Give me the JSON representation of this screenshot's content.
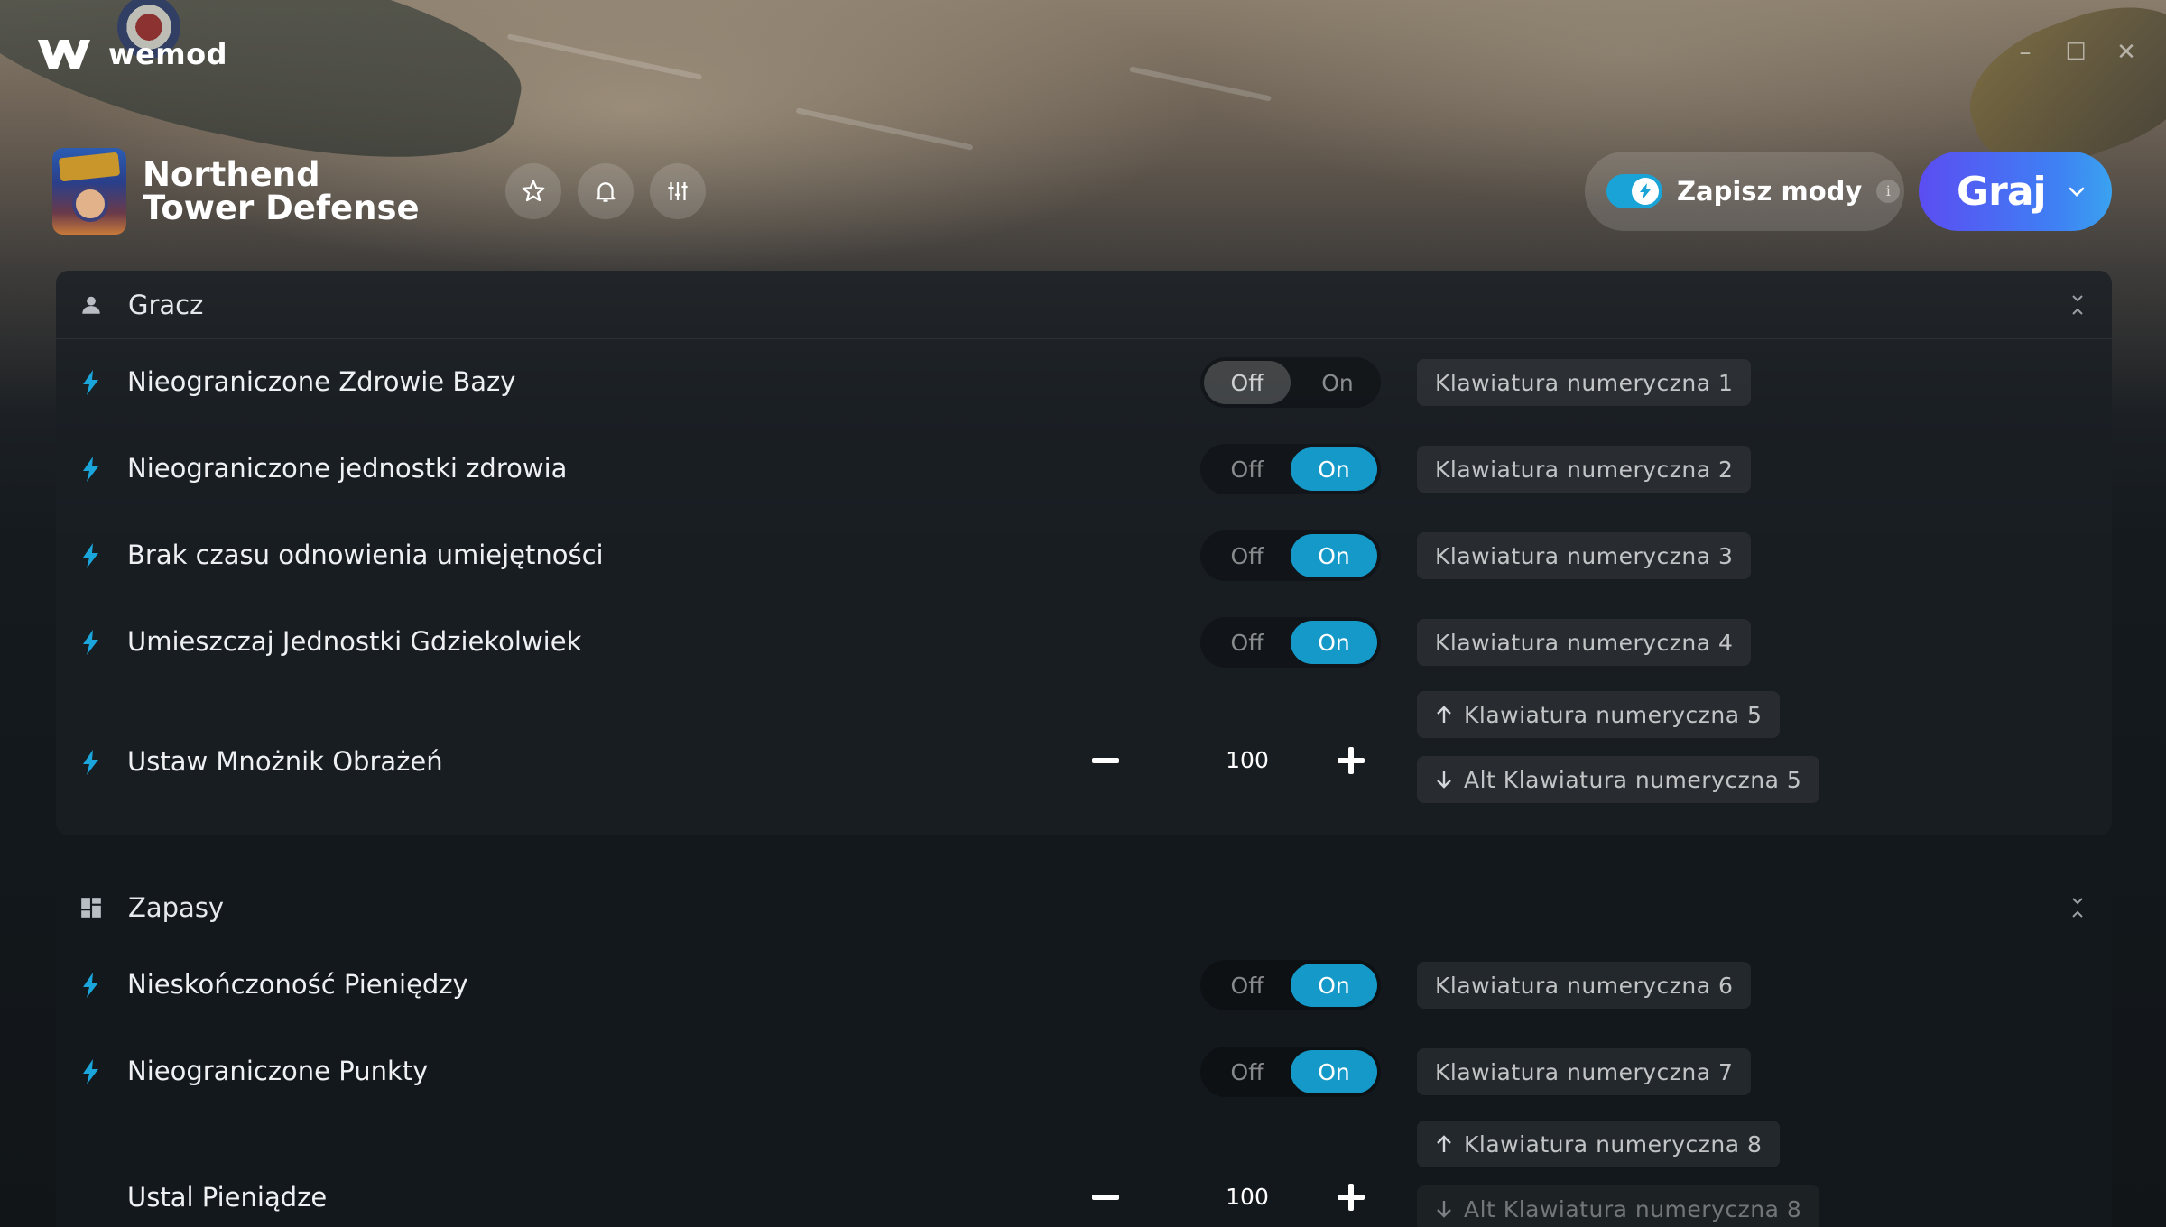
{
  "app": {
    "name": "wemod"
  },
  "game": {
    "title": "Northend Tower Defense"
  },
  "header": {
    "save_mods_label": "Zapisz mody",
    "save_mods_enabled": true,
    "play_label": "Graj"
  },
  "sections": [
    {
      "title": "Gracz",
      "icon": "person-icon",
      "rows": [
        {
          "label": "Nieograniczone Zdrowie Bazy",
          "type": "toggle",
          "off_label": "Off",
          "on_label": "On",
          "state": "off",
          "hotkey": "Klawiatura numeryczna 1"
        },
        {
          "label": "Nieograniczone jednostki zdrowia",
          "type": "toggle",
          "off_label": "Off",
          "on_label": "On",
          "state": "on",
          "hotkey": "Klawiatura numeryczna 2"
        },
        {
          "label": "Brak czasu odnowienia umiejętności",
          "type": "toggle",
          "off_label": "Off",
          "on_label": "On",
          "state": "on",
          "hotkey": "Klawiatura numeryczna 3"
        },
        {
          "label": "Umieszczaj Jednostki Gdziekolwiek",
          "type": "toggle",
          "off_label": "Off",
          "on_label": "On",
          "state": "on",
          "hotkey": "Klawiatura numeryczna 4"
        },
        {
          "label": "Ustaw Mnożnik Obrażeń",
          "type": "stepper",
          "value": "100",
          "hotkey_up": "Klawiatura numeryczna 5",
          "hotkey_down": "Alt Klawiatura numeryczna 5"
        }
      ]
    },
    {
      "title": "Zapasy",
      "icon": "grid-icon",
      "rows": [
        {
          "label": "Nieskończoność Pieniędzy",
          "type": "toggle",
          "off_label": "Off",
          "on_label": "On",
          "state": "on",
          "hotkey": "Klawiatura numeryczna 6"
        },
        {
          "label": "Nieograniczone Punkty",
          "type": "toggle",
          "off_label": "Off",
          "on_label": "On",
          "state": "on",
          "hotkey": "Klawiatura numeryczna 7"
        },
        {
          "label": "Ustal Pieniądze",
          "type": "stepper",
          "value": "100",
          "hotkey_up": "Klawiatura numeryczna 8",
          "hotkey_down": "Alt Klawiatura numeryczna 8"
        }
      ]
    }
  ],
  "colors": {
    "accent": "#1499c8",
    "play_start": "#5b4df2",
    "play_end": "#3aa2ef"
  }
}
